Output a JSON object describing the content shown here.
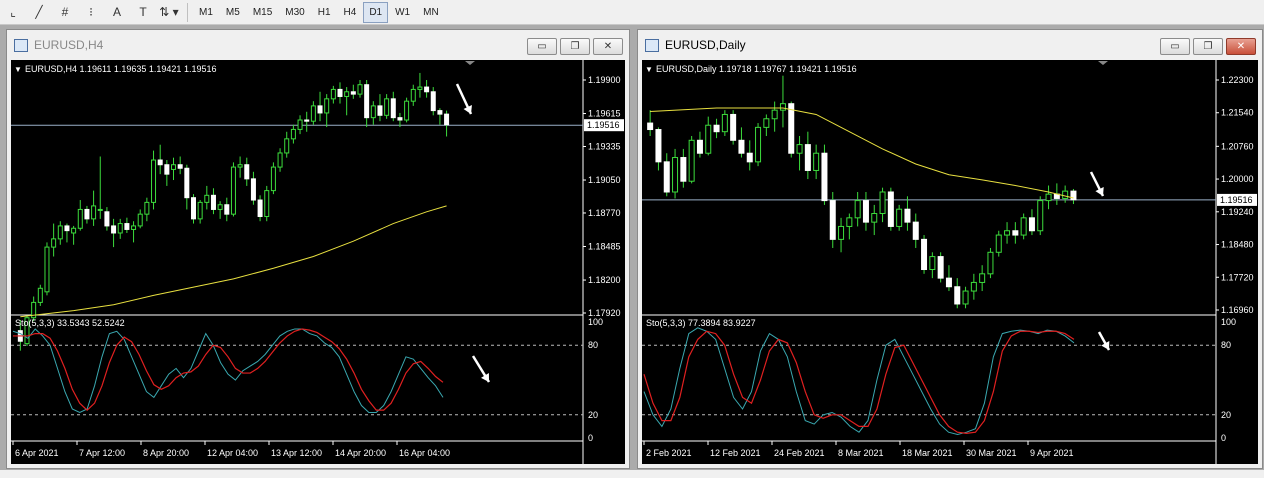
{
  "toolbar": {
    "tools": [
      {
        "icon": "cursor-tool-icon",
        "glyph": "⌞"
      },
      {
        "icon": "line-tool-icon",
        "glyph": "╱"
      },
      {
        "icon": "fibonacci-tool-icon",
        "glyph": "#"
      },
      {
        "icon": "fibo-fan-tool-icon",
        "glyph": "⁝"
      },
      {
        "icon": "text-tool-icon",
        "glyph": "A"
      },
      {
        "icon": "text-label-tool-icon",
        "glyph": "T"
      },
      {
        "icon": "arrows-tool-icon",
        "glyph": "⇅ ▾"
      }
    ],
    "timeframes": [
      "M1",
      "M5",
      "M15",
      "M30",
      "H1",
      "H4",
      "D1",
      "W1",
      "MN"
    ],
    "active_timeframe": "D1"
  },
  "windows": [
    {
      "title": "EURUSD,H4",
      "active": false,
      "info": "EURUSD,H4  1.19611 1.19635 1.19421 1.19516",
      "price_labels": [
        "1.19900",
        "1.19615",
        "1.19335",
        "1.19050",
        "1.18770",
        "1.18485",
        "1.18200",
        "1.17920"
      ],
      "current_price": "1.19516",
      "indicator_label": "Sto(5,3,3) 33.5343 52.5242",
      "indicator_levels": [
        "100",
        "80",
        "20",
        "0"
      ],
      "time_labels": [
        "6 Apr 2021",
        "7 Apr 12:00",
        "8 Apr 20:00",
        "12 Apr 04:00",
        "13 Apr 12:00",
        "14 Apr 20:00",
        "16 Apr 04:00"
      ]
    },
    {
      "title": "EURUSD,Daily",
      "active": true,
      "info": "EURUSD,Daily  1.19718 1.19767 1.19421 1.19516",
      "price_labels": [
        "1.22300",
        "1.21540",
        "1.20760",
        "1.20000",
        "1.19240",
        "1.18480",
        "1.17720",
        "1.16960"
      ],
      "current_price": "1.19516",
      "indicator_label": "Sto(5,3,3) 77.3894 83.9227",
      "indicator_levels": [
        "100",
        "80",
        "20",
        "0"
      ],
      "time_labels": [
        "2 Feb 2021",
        "12 Feb 2021",
        "24 Feb 2021",
        "8 Mar 2021",
        "18 Mar 2021",
        "30 Mar 2021",
        "9 Apr 2021"
      ]
    }
  ],
  "chart_data": [
    {
      "type": "candlestick",
      "symbol": "EURUSD",
      "timeframe": "H4",
      "ylim": [
        1.1792,
        1.199
      ],
      "ohlc": [
        [
          1.1777,
          1.1786,
          1.176,
          1.1768
        ],
        [
          1.1766,
          1.179,
          1.1764,
          1.1788
        ],
        [
          1.1788,
          1.1806,
          1.1785,
          1.1801
        ],
        [
          1.1801,
          1.1816,
          1.1798,
          1.1813
        ],
        [
          1.181,
          1.1852,
          1.1807,
          1.1848
        ],
        [
          1.1848,
          1.1868,
          1.184,
          1.1855
        ],
        [
          1.1855,
          1.187,
          1.185,
          1.1866
        ],
        [
          1.1866,
          1.1868,
          1.1852,
          1.1862
        ],
        [
          1.186,
          1.1866,
          1.185,
          1.1864
        ],
        [
          1.1864,
          1.1888,
          1.1862,
          1.188
        ],
        [
          1.188,
          1.1883,
          1.1868,
          1.1872
        ],
        [
          1.1872,
          1.1896,
          1.1866,
          1.1883
        ],
        [
          1.188,
          1.1925,
          1.1872,
          1.188
        ],
        [
          1.1878,
          1.1882,
          1.1862,
          1.1866
        ],
        [
          1.1866,
          1.1872,
          1.1848,
          1.186
        ],
        [
          1.186,
          1.1872,
          1.1855,
          1.1868
        ],
        [
          1.1868,
          1.1873,
          1.186,
          1.1863
        ],
        [
          1.1863,
          1.187,
          1.1852,
          1.1866
        ],
        [
          1.1866,
          1.188,
          1.1864,
          1.1876
        ],
        [
          1.1876,
          1.189,
          1.187,
          1.1886
        ],
        [
          1.1886,
          1.193,
          1.188,
          1.1922
        ],
        [
          1.1922,
          1.1935,
          1.191,
          1.1918
        ],
        [
          1.1918,
          1.1922,
          1.19,
          1.191
        ],
        [
          1.1914,
          1.1924,
          1.1905,
          1.1918
        ],
        [
          1.1918,
          1.1925,
          1.191,
          1.1915
        ],
        [
          1.1915,
          1.1918,
          1.188,
          1.189
        ],
        [
          1.189,
          1.1893,
          1.1868,
          1.1872
        ],
        [
          1.1872,
          1.1888,
          1.1868,
          1.1886
        ],
        [
          1.1886,
          1.19,
          1.188,
          1.1892
        ],
        [
          1.1892,
          1.1898,
          1.1876,
          1.188
        ],
        [
          1.188,
          1.1887,
          1.1872,
          1.1884
        ],
        [
          1.1884,
          1.189,
          1.187,
          1.1876
        ],
        [
          1.1876,
          1.192,
          1.1874,
          1.1916
        ],
        [
          1.1916,
          1.1925,
          1.1907,
          1.1918
        ],
        [
          1.1918,
          1.1924,
          1.19,
          1.1906
        ],
        [
          1.1906,
          1.1912,
          1.1884,
          1.1888
        ],
        [
          1.1888,
          1.1892,
          1.187,
          1.1874
        ],
        [
          1.1874,
          1.19,
          1.187,
          1.1896
        ],
        [
          1.1896,
          1.192,
          1.1893,
          1.1916
        ],
        [
          1.1916,
          1.1932,
          1.1912,
          1.1928
        ],
        [
          1.1928,
          1.1946,
          1.1924,
          1.194
        ],
        [
          1.194,
          1.1952,
          1.1936,
          1.1948
        ],
        [
          1.1948,
          1.196,
          1.1944,
          1.1956
        ],
        [
          1.1956,
          1.1963,
          1.1946,
          1.1955
        ],
        [
          1.1955,
          1.1972,
          1.1952,
          1.1968
        ],
        [
          1.1968,
          1.198,
          1.1955,
          1.1962
        ],
        [
          1.1962,
          1.1978,
          1.195,
          1.1974
        ],
        [
          1.1974,
          1.1985,
          1.197,
          1.1982
        ],
        [
          1.1982,
          1.1988,
          1.197,
          1.1976
        ],
        [
          1.1976,
          1.1984,
          1.196,
          1.198
        ],
        [
          1.198,
          1.1986,
          1.1974,
          1.1978
        ],
        [
          1.1978,
          1.199,
          1.1975,
          1.1986
        ],
        [
          1.1986,
          1.199,
          1.195,
          1.1958
        ],
        [
          1.1958,
          1.1972,
          1.1952,
          1.1968
        ],
        [
          1.1968,
          1.1978,
          1.1955,
          1.196
        ],
        [
          1.196,
          1.1978,
          1.1957,
          1.1974
        ],
        [
          1.1974,
          1.198,
          1.1955,
          1.1958
        ],
        [
          1.1958,
          1.1962,
          1.195,
          1.1956
        ],
        [
          1.1956,
          1.1975,
          1.1954,
          1.1972
        ],
        [
          1.1972,
          1.1986,
          1.1968,
          1.1982
        ],
        [
          1.1982,
          1.1996,
          1.1975,
          1.1984
        ],
        [
          1.1984,
          1.199,
          1.1975,
          1.198
        ],
        [
          1.198,
          1.1984,
          1.196,
          1.1964
        ],
        [
          1.1964,
          1.1966,
          1.1952,
          1.1961
        ],
        [
          1.1961,
          1.1964,
          1.1942,
          1.1952
        ]
      ],
      "moving_average_color": "#e8e040",
      "moving_average": [
        [
          0,
          1.17888
        ],
        [
          8,
          1.1794
        ],
        [
          14,
          1.1799
        ],
        [
          20,
          1.1807
        ],
        [
          26,
          1.1814
        ],
        [
          32,
          1.1821
        ],
        [
          38,
          1.183
        ],
        [
          44,
          1.184
        ],
        [
          50,
          1.1853
        ],
        [
          56,
          1.1868
        ],
        [
          61,
          1.1878
        ],
        [
          64,
          1.1883
        ]
      ],
      "stochastic": {
        "main_color": "#3aa8b0",
        "signal_color": "#e02020",
        "main": [
          92,
          90,
          86,
          94,
          88,
          80,
          60,
          40,
          25,
          22,
          25,
          45,
          70,
          90,
          92,
          85,
          70,
          55,
          40,
          35,
          45,
          55,
          60,
          52,
          60,
          75,
          90,
          80,
          65,
          55,
          50,
          58,
          62,
          66,
          72,
          80,
          88,
          92,
          94,
          94,
          90,
          88,
          82,
          78,
          70,
          55,
          40,
          28,
          22,
          22,
          28,
          40,
          55,
          70,
          68,
          60,
          52,
          45,
          35
        ],
        "signal": [
          88,
          88,
          88,
          90,
          90,
          86,
          75,
          60,
          42,
          30,
          24,
          30,
          45,
          65,
          80,
          87,
          83,
          72,
          58,
          46,
          42,
          45,
          52,
          56,
          57,
          62,
          72,
          80,
          78,
          70,
          60,
          56,
          56,
          60,
          66,
          74,
          82,
          88,
          92,
          94,
          93,
          91,
          87,
          83,
          77,
          68,
          56,
          42,
          32,
          24,
          24,
          30,
          42,
          56,
          64,
          66,
          60,
          53,
          48
        ]
      },
      "annotations": [
        "down-arrow",
        "down-arrow"
      ]
    },
    {
      "type": "candlestick",
      "symbol": "EURUSD",
      "timeframe": "Daily",
      "ylim": [
        1.1696,
        1.223
      ],
      "ohlc": [
        [
          1.213,
          1.216,
          1.21,
          1.2115
        ],
        [
          1.2115,
          1.212,
          1.202,
          1.204
        ],
        [
          1.204,
          1.206,
          1.196,
          1.197
        ],
        [
          1.197,
          1.207,
          1.1955,
          1.205
        ],
        [
          1.205,
          1.207,
          1.198,
          1.1995
        ],
        [
          1.1995,
          1.21,
          1.199,
          1.209
        ],
        [
          1.209,
          1.211,
          1.205,
          1.206
        ],
        [
          1.206,
          1.2145,
          1.2055,
          1.2125
        ],
        [
          1.2125,
          1.214,
          1.2095,
          1.211
        ],
        [
          1.211,
          1.216,
          1.21,
          1.215
        ],
        [
          1.215,
          1.216,
          1.208,
          1.209
        ],
        [
          1.209,
          1.212,
          1.205,
          1.206
        ],
        [
          1.206,
          1.209,
          1.202,
          1.204
        ],
        [
          1.204,
          1.213,
          1.203,
          1.212
        ],
        [
          1.212,
          1.215,
          1.21,
          1.214
        ],
        [
          1.214,
          1.218,
          1.211,
          1.216
        ],
        [
          1.216,
          1.224,
          1.212,
          1.2175
        ],
        [
          1.2175,
          1.218,
          1.205,
          1.206
        ],
        [
          1.206,
          1.21,
          1.202,
          1.208
        ],
        [
          1.208,
          1.211,
          1.2,
          1.202
        ],
        [
          1.202,
          1.208,
          1.2,
          1.206
        ],
        [
          1.206,
          1.208,
          1.194,
          1.195
        ],
        [
          1.195,
          1.197,
          1.184,
          1.186
        ],
        [
          1.186,
          1.191,
          1.183,
          1.189
        ],
        [
          1.189,
          1.192,
          1.186,
          1.191
        ],
        [
          1.191,
          1.197,
          1.189,
          1.195
        ],
        [
          1.195,
          1.197,
          1.188,
          1.19
        ],
        [
          1.19,
          1.194,
          1.187,
          1.192
        ],
        [
          1.192,
          1.198,
          1.19,
          1.197
        ],
        [
          1.197,
          1.198,
          1.188,
          1.189
        ],
        [
          1.189,
          1.194,
          1.188,
          1.193
        ],
        [
          1.193,
          1.196,
          1.188,
          1.19
        ],
        [
          1.19,
          1.192,
          1.184,
          1.186
        ],
        [
          1.186,
          1.187,
          1.178,
          1.179
        ],
        [
          1.179,
          1.183,
          1.177,
          1.182
        ],
        [
          1.182,
          1.183,
          1.176,
          1.177
        ],
        [
          1.177,
          1.18,
          1.174,
          1.175
        ],
        [
          1.175,
          1.177,
          1.17,
          1.171
        ],
        [
          1.171,
          1.175,
          1.17,
          1.174
        ],
        [
          1.174,
          1.178,
          1.172,
          1.176
        ],
        [
          1.176,
          1.18,
          1.174,
          1.178
        ],
        [
          1.178,
          1.184,
          1.177,
          1.183
        ],
        [
          1.183,
          1.188,
          1.182,
          1.187
        ],
        [
          1.187,
          1.19,
          1.185,
          1.188
        ],
        [
          1.188,
          1.19,
          1.185,
          1.187
        ],
        [
          1.187,
          1.192,
          1.186,
          1.191
        ],
        [
          1.191,
          1.193,
          1.187,
          1.188
        ],
        [
          1.188,
          1.196,
          1.187,
          1.195
        ],
        [
          1.195,
          1.1985,
          1.193,
          1.1965
        ],
        [
          1.1965,
          1.199,
          1.194,
          1.1955
        ],
        [
          1.1955,
          1.1985,
          1.1945,
          1.1972
        ],
        [
          1.1972,
          1.1977,
          1.1942,
          1.1952
        ]
      ],
      "moving_average_color": "#e8e040",
      "moving_average": [
        [
          0,
          1.2157
        ],
        [
          8,
          1.2165
        ],
        [
          16,
          1.2165
        ],
        [
          20,
          1.215
        ],
        [
          24,
          1.211
        ],
        [
          28,
          1.207
        ],
        [
          32,
          1.2035
        ],
        [
          36,
          1.201
        ],
        [
          40,
          1.1998
        ],
        [
          44,
          1.1985
        ],
        [
          48,
          1.197
        ],
        [
          51,
          1.1956
        ]
      ],
      "stochastic": {
        "main_color": "#3aa8b0",
        "signal_color": "#e02020",
        "main": [
          40,
          20,
          10,
          25,
          60,
          90,
          95,
          92,
          85,
          60,
          35,
          25,
          40,
          75,
          90,
          85,
          70,
          40,
          15,
          12,
          20,
          22,
          18,
          10,
          5,
          15,
          50,
          80,
          85,
          70,
          55,
          40,
          25,
          12,
          5,
          3,
          5,
          8,
          30,
          70,
          90,
          92,
          93,
          92,
          90,
          93,
          92,
          88,
          82
        ],
        "signal": [
          55,
          30,
          15,
          15,
          35,
          70,
          85,
          92,
          90,
          80,
          55,
          35,
          30,
          50,
          75,
          85,
          82,
          65,
          40,
          20,
          17,
          20,
          20,
          15,
          10,
          10,
          25,
          55,
          78,
          80,
          65,
          50,
          35,
          20,
          10,
          5,
          4,
          5,
          15,
          40,
          75,
          88,
          92,
          92,
          91,
          92,
          92,
          90,
          85
        ]
      },
      "annotations": [
        "down-arrow",
        "down-arrow"
      ]
    }
  ]
}
